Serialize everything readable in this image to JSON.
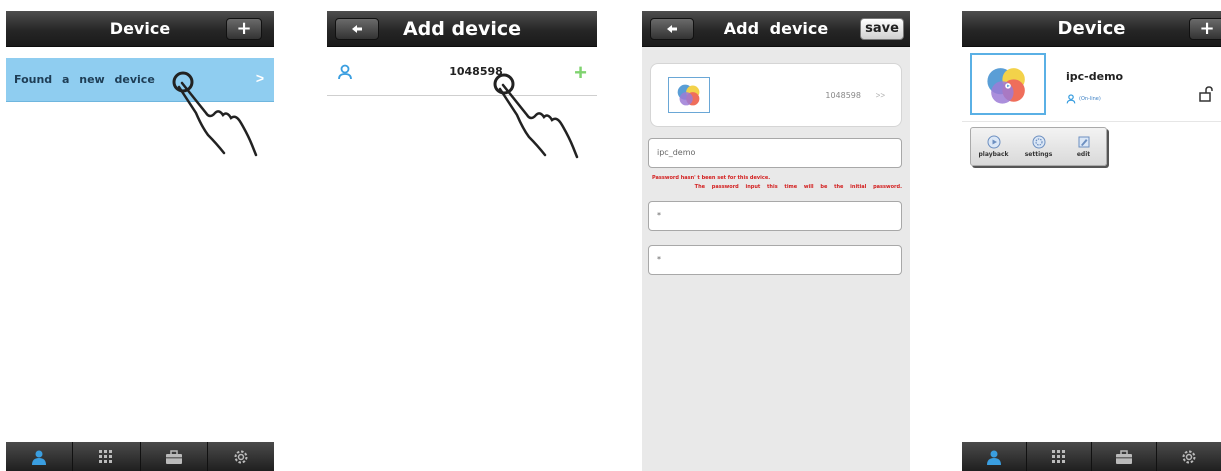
{
  "screen1": {
    "title": "Device",
    "add_label": "+",
    "found_label": "Found a new device",
    "chevron": ">",
    "tabs": [
      "person-icon",
      "grid-icon",
      "toolbox-icon",
      "gear-icon"
    ]
  },
  "screen2": {
    "title": "Add device",
    "device_id": "1048598",
    "add_symbol": "+"
  },
  "screen3": {
    "title": "Add device",
    "save_label": "save",
    "device_id": "1048598",
    "arrow": ">>",
    "name_value": "ipc_demo",
    "warning_line1": "Password hasn' t been set for this device.",
    "warning_line2": "The password input this time will be the initial password.",
    "password_value": "*",
    "confirm_value": "*"
  },
  "screen4": {
    "title": "Device",
    "add_label": "+",
    "device_name": "ipc-demo",
    "device_status": "(On-line)",
    "actions": [
      "playback",
      "settings",
      "edit"
    ],
    "tabs": [
      "person-icon",
      "grid-icon",
      "toolbox-icon",
      "gear-icon"
    ]
  },
  "colors": {
    "titlebar": "#262626",
    "highlight_row": "#8fcdf0",
    "accent_blue": "#3a9ee0",
    "plus_green": "#7fd36f",
    "warning_red": "#d32020"
  }
}
